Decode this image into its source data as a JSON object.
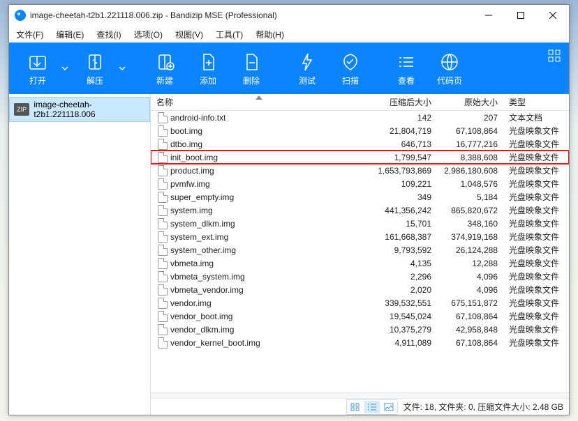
{
  "window": {
    "title": "image-cheetah-t2b1.221118.006.zip - Bandizip MSE (Professional)"
  },
  "menu": {
    "file": "文件(F)",
    "edit": "编辑(E)",
    "find": "查找(I)",
    "options": "选项(O)",
    "view": "视图(V)",
    "tools": "工具(T)",
    "help": "帮助(H)"
  },
  "toolbar": {
    "open": "打开",
    "extract": "解压",
    "new": "新建",
    "add": "添加",
    "delete": "删除",
    "test": "测试",
    "scan": "扫描",
    "view": "查看",
    "codepage": "代码页"
  },
  "tree": {
    "archive_name": "image-cheetah-t2b1.221118.006"
  },
  "columns": {
    "name": "名称",
    "compressed": "压缩后大小",
    "original": "原始大小",
    "type": "类型"
  },
  "types": {
    "text": "文本文档",
    "disc": "光盘映象文件"
  },
  "files": [
    {
      "name": "android-info.txt",
      "comp": "142",
      "orig": "207",
      "type": "text",
      "hl": false
    },
    {
      "name": "boot.img",
      "comp": "21,804,719",
      "orig": "67,108,864",
      "type": "disc",
      "hl": false
    },
    {
      "name": "dtbo.img",
      "comp": "646,713",
      "orig": "16,777,216",
      "type": "disc",
      "hl": false
    },
    {
      "name": "init_boot.img",
      "comp": "1,799,547",
      "orig": "8,388,608",
      "type": "disc",
      "hl": true
    },
    {
      "name": "product.img",
      "comp": "1,653,793,869",
      "orig": "2,986,180,608",
      "type": "disc",
      "hl": false
    },
    {
      "name": "pvmfw.img",
      "comp": "109,221",
      "orig": "1,048,576",
      "type": "disc",
      "hl": false
    },
    {
      "name": "super_empty.img",
      "comp": "349",
      "orig": "5,184",
      "type": "disc",
      "hl": false
    },
    {
      "name": "system.img",
      "comp": "441,356,242",
      "orig": "865,820,672",
      "type": "disc",
      "hl": false
    },
    {
      "name": "system_dlkm.img",
      "comp": "15,701",
      "orig": "348,160",
      "type": "disc",
      "hl": false
    },
    {
      "name": "system_ext.img",
      "comp": "161,668,387",
      "orig": "374,919,168",
      "type": "disc",
      "hl": false
    },
    {
      "name": "system_other.img",
      "comp": "9,793,592",
      "orig": "26,124,288",
      "type": "disc",
      "hl": false
    },
    {
      "name": "vbmeta.img",
      "comp": "4,135",
      "orig": "12,288",
      "type": "disc",
      "hl": false
    },
    {
      "name": "vbmeta_system.img",
      "comp": "2,296",
      "orig": "4,096",
      "type": "disc",
      "hl": false
    },
    {
      "name": "vbmeta_vendor.img",
      "comp": "2,020",
      "orig": "4,096",
      "type": "disc",
      "hl": false
    },
    {
      "name": "vendor.img",
      "comp": "339,532,551",
      "orig": "675,151,872",
      "type": "disc",
      "hl": false
    },
    {
      "name": "vendor_boot.img",
      "comp": "19,545,024",
      "orig": "67,108,864",
      "type": "disc",
      "hl": false
    },
    {
      "name": "vendor_dlkm.img",
      "comp": "10,375,279",
      "orig": "42,958,848",
      "type": "disc",
      "hl": false
    },
    {
      "name": "vendor_kernel_boot.img",
      "comp": "4,911,089",
      "orig": "67,108,864",
      "type": "disc",
      "hl": false
    }
  ],
  "status": "文件: 18, 文件夹: 0, 压缩文件大小: 2.48 GB"
}
